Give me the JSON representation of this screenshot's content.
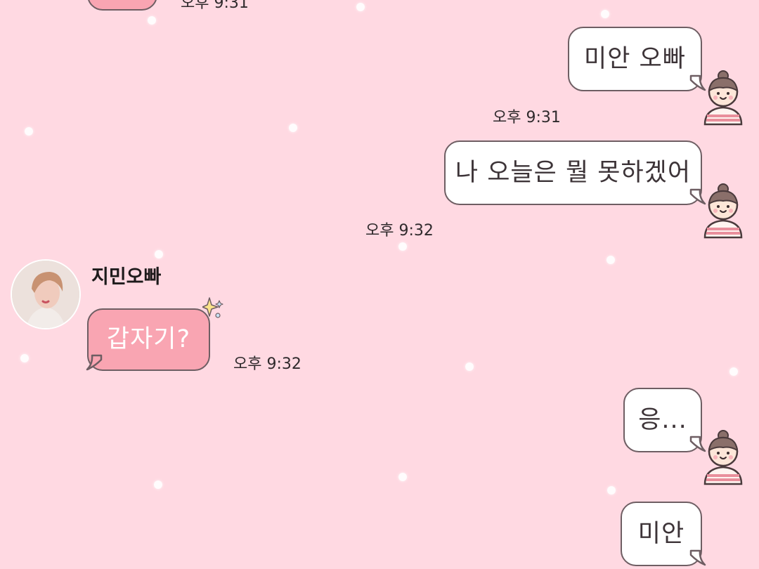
{
  "chat": {
    "contact_name": "지민오빠",
    "messages": [
      {
        "from": "me",
        "text": "미안 오빠",
        "time": "오후 9:31"
      },
      {
        "from": "me",
        "text": "나 오늘은 뭘 못하겠어",
        "time": "오후 9:32"
      },
      {
        "from": "contact",
        "text": "갑자기?",
        "time": "오후 9:32"
      },
      {
        "from": "me",
        "text": "응...",
        "time": ""
      },
      {
        "from": "me",
        "text": "미안",
        "time": ""
      }
    ],
    "top_partial_time": "오후 9:31"
  },
  "colors": {
    "background": "#ffd9e2",
    "outgoing_bubble": "#ffffff",
    "incoming_bubble": "#f9a5b2",
    "bubble_border": "#6e5e63"
  },
  "icons": {
    "self_avatar": "girl-avatar-icon",
    "contact_avatar": "profile-photo",
    "sparkle": "sparkle-icon"
  }
}
